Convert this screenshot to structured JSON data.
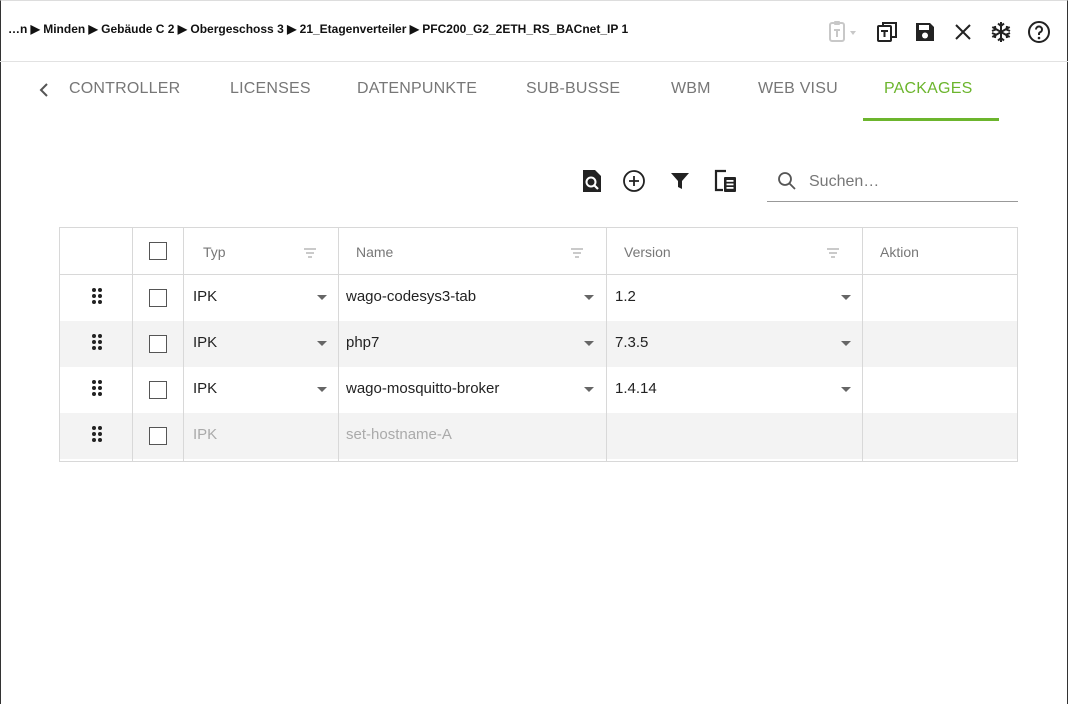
{
  "header": {
    "breadcrumb": "…n ▶ Minden ▶ Gebäude C 2 ▶ Obergeschoss 3 ▶ 21_Etagenverteiler ▶ PFC200_G2_2ETH_RS_BACnet_IP 1",
    "icons": [
      "clipboard-dropdown-icon",
      "copy-icon",
      "save-icon",
      "close-icon",
      "snowflake-icon",
      "help-icon"
    ]
  },
  "tabs": [
    "CONTROLLER",
    "LICENSES",
    "DATENPUNKTE",
    "SUB-BUSSE",
    "WBM",
    "WEB VISU",
    "PACKAGES"
  ],
  "active_tab": "PACKAGES",
  "toolbar": {
    "search_placeholder": "Suchen…"
  },
  "table": {
    "columns": [
      "Typ",
      "Name",
      "Version",
      "Aktion"
    ],
    "rows": [
      {
        "typ": "IPK",
        "name": "wago-codesys3-tab",
        "version": "1.2",
        "enabled": true
      },
      {
        "typ": "IPK",
        "name": "php7",
        "version": "7.3.5",
        "enabled": true
      },
      {
        "typ": "IPK",
        "name": "wago-mosquitto-broker",
        "version": "1.4.14",
        "enabled": true
      },
      {
        "typ": "IPK",
        "name": "set-hostname-A",
        "version": "",
        "enabled": false
      }
    ]
  },
  "colors": {
    "accent": "#6cb52d",
    "alt_row": "#f3f3f3"
  }
}
